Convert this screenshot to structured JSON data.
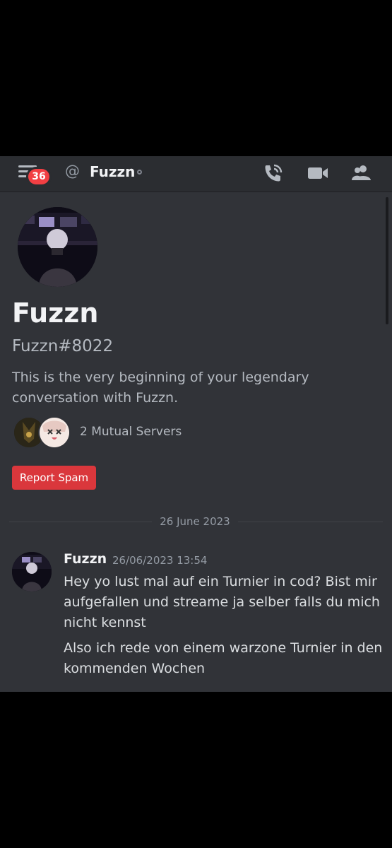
{
  "header": {
    "unread_count": "36",
    "title": "Fuzzn",
    "icons": [
      "menu-icon",
      "at-icon",
      "phone-call-icon",
      "video-icon",
      "members-icon"
    ]
  },
  "profile": {
    "name": "Fuzzn",
    "tag": "Fuzzn#8022",
    "intro": "This is the very beginning of your legendary conversation with Fuzzn.",
    "mutual_servers": "2 Mutual Servers",
    "report_button": "Report Spam"
  },
  "divider": {
    "date": "26 June 2023"
  },
  "message": {
    "author": "Fuzzn",
    "timestamp": "26/06/2023 13:54",
    "lines": [
      "Hey yo lust mal auf ein Turnier in cod? Bist mir aufgefallen und streame ja selber falls du mich nicht kennst",
      "Also ich rede von einem warzone Turnier in den kommenden Wochen"
    ]
  },
  "colors": {
    "background": "#313338",
    "header": "#2b2d31",
    "danger": "#da373c",
    "badge": "#f23f43",
    "muted_text": "#b5bac1"
  }
}
